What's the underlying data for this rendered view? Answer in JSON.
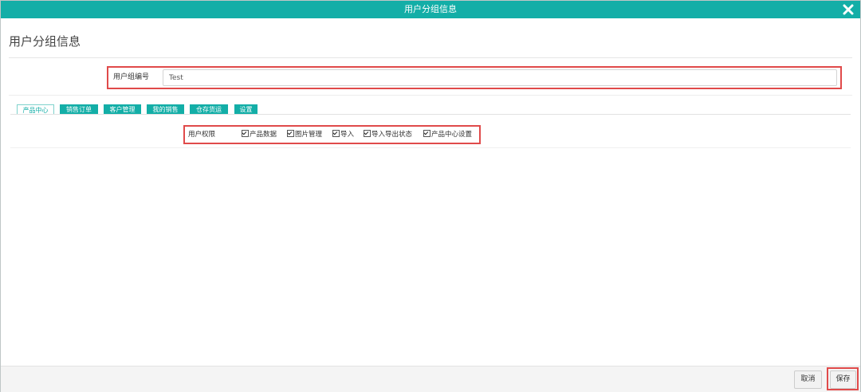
{
  "window": {
    "title": "用户分组信息"
  },
  "page": {
    "title": "用户分组信息"
  },
  "group_field": {
    "label": "用户组编号",
    "value": "Test"
  },
  "tabs": [
    {
      "label": "产品中心",
      "active": true
    },
    {
      "label": "销售订单",
      "active": false
    },
    {
      "label": "客户管理",
      "active": false
    },
    {
      "label": "我的销售",
      "active": false
    },
    {
      "label": "仓存货运",
      "active": false
    },
    {
      "label": "设置",
      "active": false
    }
  ],
  "permissions": {
    "label": "用户权限",
    "options": [
      {
        "label": "产品数据",
        "checked": true
      },
      {
        "label": "图片管理",
        "checked": true
      },
      {
        "label": "导入",
        "checked": true
      },
      {
        "label": "导入导出状态",
        "checked": true
      },
      {
        "label": "产品中心设置",
        "checked": true
      }
    ]
  },
  "footer": {
    "cancel_label": "取消",
    "save_label": "保存"
  },
  "colors": {
    "accent": "#13aea7",
    "highlight_border": "#e04a4a"
  },
  "icons": {
    "close": "close-icon",
    "checkbox": "checkbox-checked-icon"
  }
}
